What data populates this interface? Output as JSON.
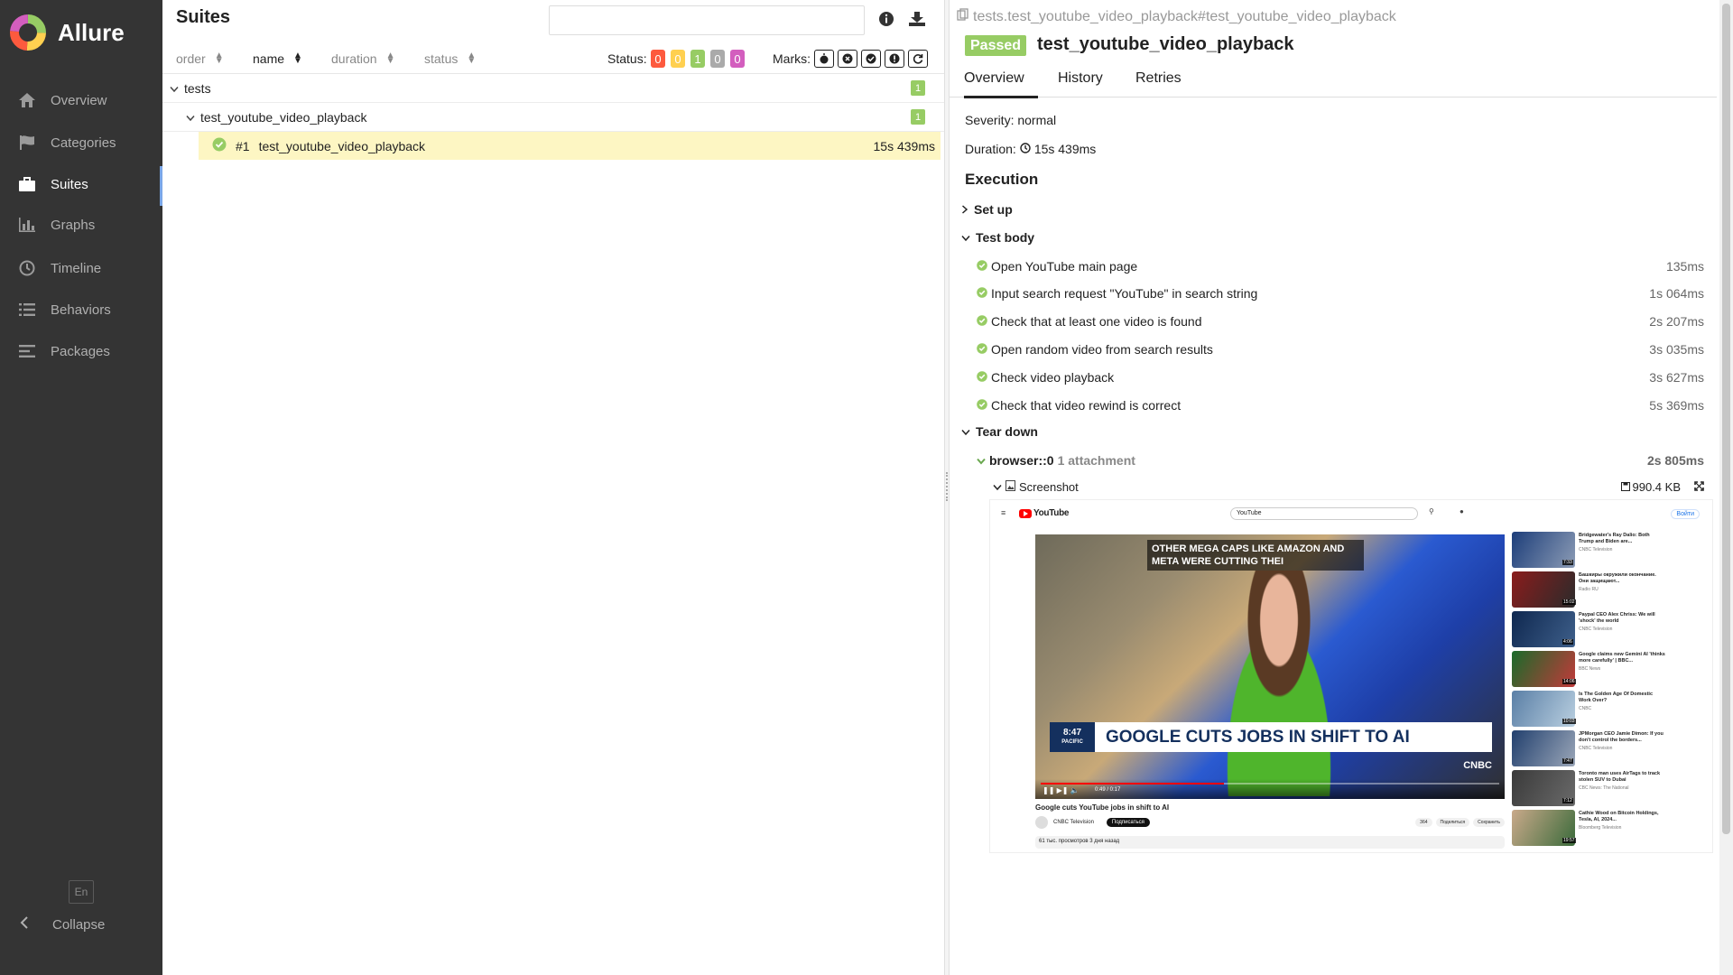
{
  "sidebar": {
    "brand": "Allure",
    "items": [
      {
        "label": "Overview",
        "icon": "home-icon"
      },
      {
        "label": "Categories",
        "icon": "flag-icon"
      },
      {
        "label": "Suites",
        "icon": "briefcase-icon",
        "active": true
      },
      {
        "label": "Graphs",
        "icon": "bar-chart-icon"
      },
      {
        "label": "Timeline",
        "icon": "clock-icon"
      },
      {
        "label": "Behaviors",
        "icon": "list-icon"
      },
      {
        "label": "Packages",
        "icon": "align-left-icon"
      }
    ],
    "language": "En",
    "collapse": "Collapse"
  },
  "suites": {
    "title": "Suites",
    "search_value": "",
    "sort": {
      "order": "order",
      "name": "name",
      "duration": "duration",
      "status": "status"
    },
    "status_label": "Status:",
    "status_counts": [
      {
        "value": "0",
        "color": "#fd5a3e"
      },
      {
        "value": "0",
        "color": "#ffd050"
      },
      {
        "value": "1",
        "color": "#97cc64"
      },
      {
        "value": "0",
        "color": "#aaaaaa"
      },
      {
        "value": "0",
        "color": "#d35ebe"
      }
    ],
    "marks_label": "Marks:",
    "tree": {
      "root": {
        "label": "tests",
        "count": "1"
      },
      "child": {
        "label": "test_youtube_video_playback",
        "count": "1"
      },
      "case": {
        "index": "#1",
        "label": "test_youtube_video_playback",
        "duration": "15s 439ms"
      }
    }
  },
  "detail": {
    "breadcrumb": "tests.test_youtube_video_playback#test_youtube_video_playback",
    "status": "Passed",
    "title": "test_youtube_video_playback",
    "tabs": [
      "Overview",
      "History",
      "Retries"
    ],
    "severity": "Severity: normal",
    "duration_label": "Duration:",
    "duration_value": "15s 439ms",
    "execution_title": "Execution",
    "setup": "Set up",
    "test_body": "Test body",
    "steps": [
      {
        "name": "Open YouTube main page",
        "time": "135ms"
      },
      {
        "name": "Input search request \"YouTube\" in search string",
        "time": "1s 064ms"
      },
      {
        "name": "Check that at least one video is found",
        "time": "2s 207ms"
      },
      {
        "name": "Open random video from search results",
        "time": "3s 035ms"
      },
      {
        "name": "Check video playback",
        "time": "3s 627ms"
      },
      {
        "name": "Check that video rewind is correct",
        "time": "5s 369ms"
      }
    ],
    "teardown": "Tear down",
    "browser": {
      "name": "browser::0",
      "attachments": "1 attachment",
      "time": "2s 805ms"
    },
    "screenshot": {
      "name": "Screenshot",
      "size": "990.4 KB"
    }
  },
  "youtube_shot": {
    "logo": "YouTube",
    "search": "YouTube",
    "signin": "Войти",
    "top_caption": "OTHER MEGA CAPS LIKE AMAZON AND META WERE CUTTING THEI",
    "clock": "8:47",
    "clock_zone": "PACIFIC",
    "headline": "GOOGLE CUTS JOBS IN SHIFT TO AI",
    "network": "CNBC",
    "time": "0:49 / 0:17",
    "video_title": "Google cuts YouTube jobs in shift to AI",
    "channel": "CNBC Television",
    "subscribe": "Подписаться",
    "actions": [
      "364",
      "Поделиться",
      "Сохранить"
    ],
    "views": "61 тыс. просмотров  3 дня назад",
    "recs": [
      {
        "title": "Bridgewater's Ray Dalio: Both Trump and Biden are...",
        "channel": "CNBC Television",
        "dur": "7:33"
      },
      {
        "title": "Башкиры окружили окончание. Они защищают...",
        "channel": "Radio RU",
        "dur": "15:02"
      },
      {
        "title": "Paypal CEO Alex Chriss: We will 'shock' the world",
        "channel": "CNBC Television",
        "dur": "4:06"
      },
      {
        "title": "Google claims new Gemini AI 'thinks more carefully' | BBC...",
        "channel": "BBC News",
        "dur": "14:06"
      },
      {
        "title": "Is The Golden Age Of Domestic Work Over?",
        "channel": "CNBC",
        "dur": "10:03"
      },
      {
        "title": "JPMorgan CEO Jamie Dimon: If you don't control the borders...",
        "channel": "CNBC Television",
        "dur": "7:47"
      },
      {
        "title": "Toronto man uses AirTags to track stolen SUV to Dubai",
        "channel": "CBC News: The National",
        "dur": "7:12"
      },
      {
        "title": "Cathie Wood on Bitcoin Holdings, Tesla, AI, 2024...",
        "channel": "Bloomberg Television",
        "dur": "19:57"
      }
    ]
  }
}
